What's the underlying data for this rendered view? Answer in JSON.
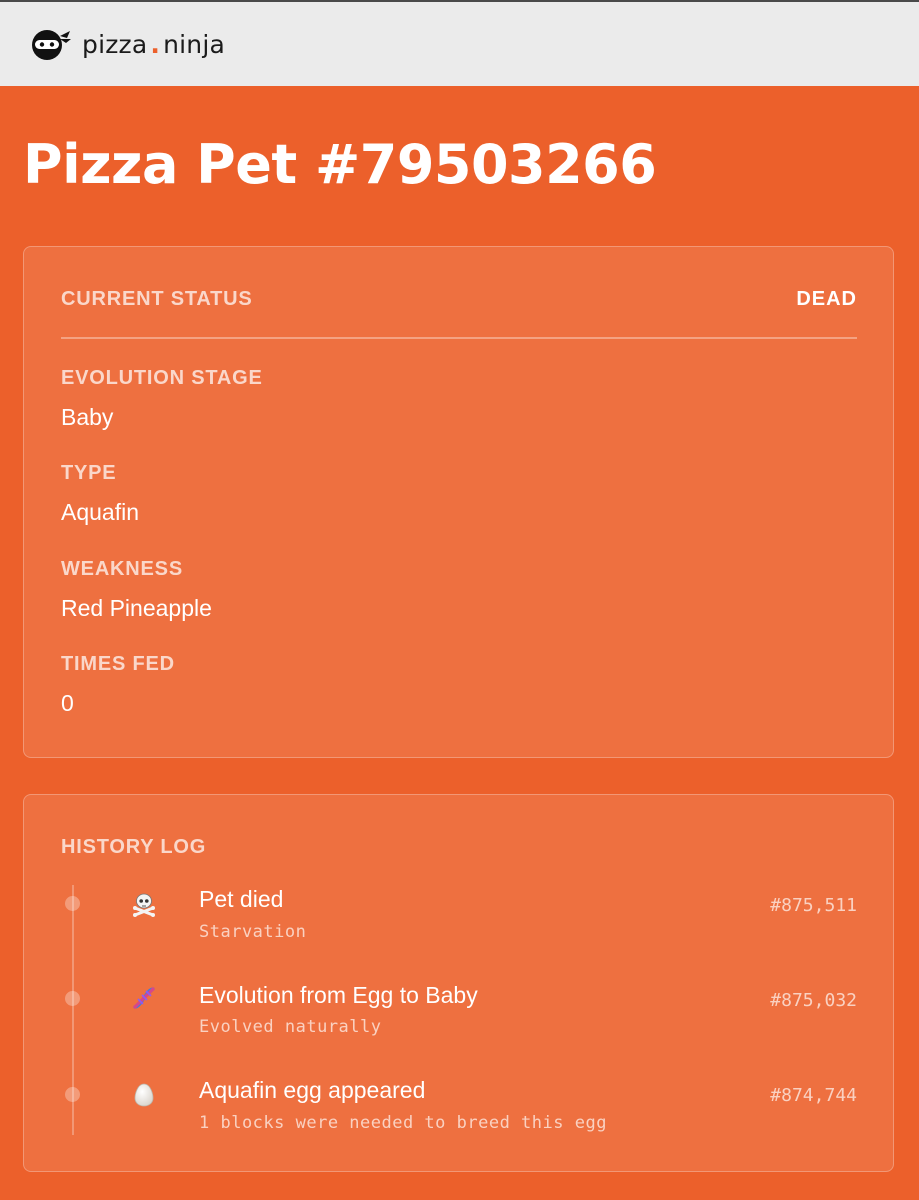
{
  "header": {
    "brand_left": "pizza",
    "brand_dot": ".",
    "brand_right": "ninja",
    "logo_icon": "ninja-icon"
  },
  "page": {
    "title": "Pizza Pet #79503266"
  },
  "status_card": {
    "status_label": "CURRENT STATUS",
    "status_value": "DEAD",
    "fields": [
      {
        "label": "EVOLUTION STAGE",
        "value": "Baby"
      },
      {
        "label": "TYPE",
        "value": "Aquafin"
      },
      {
        "label": "WEAKNESS",
        "value": "Red Pineapple"
      },
      {
        "label": "TIMES FED",
        "value": "0"
      }
    ]
  },
  "history": {
    "title": "HISTORY LOG",
    "entries": [
      {
        "icon": "skull-crossbones-icon",
        "title": "Pet died",
        "subtitle": "Starvation",
        "block": "#875,511"
      },
      {
        "icon": "dna-icon",
        "title": "Evolution from Egg to Baby",
        "subtitle": "Evolved naturally",
        "block": "#875,032"
      },
      {
        "icon": "egg-icon",
        "title": "Aquafin egg appeared",
        "subtitle": "1 blocks were needed to breed this egg",
        "block": "#874,744"
      }
    ]
  },
  "colors": {
    "background": "#EC602B",
    "topbar": "#EBEBEB",
    "accent": "#EC602B"
  }
}
